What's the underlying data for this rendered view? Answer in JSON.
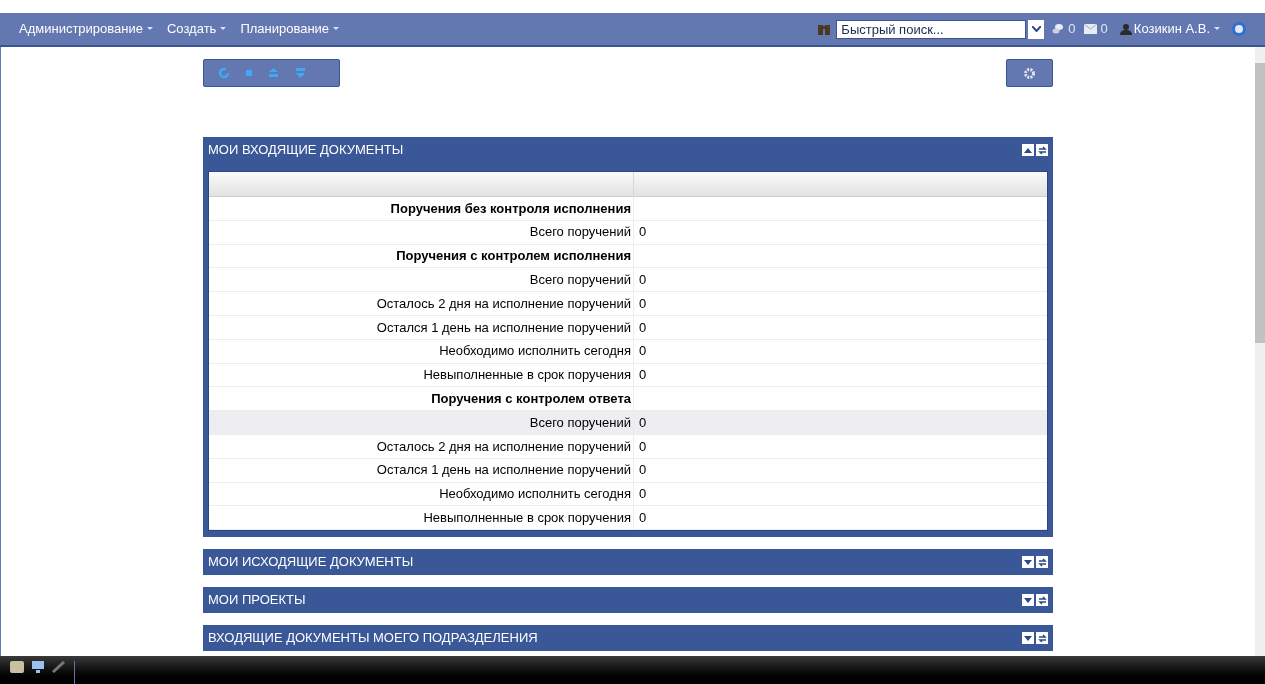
{
  "menu": [
    {
      "label": "Администрирование"
    },
    {
      "label": "Создать"
    },
    {
      "label": "Планирование"
    }
  ],
  "search": {
    "placeholder": "Быстрый поиск..."
  },
  "counters": [
    {
      "kind": "chat",
      "value": "0"
    },
    {
      "kind": "mail",
      "value": "0"
    }
  ],
  "user": {
    "name": "Козикин А.В."
  },
  "panels": [
    {
      "title": "МОИ ВХОДЯЩИЕ ДОКУМЕНТЫ",
      "expanded": true,
      "rows": [
        {
          "kind": "group",
          "label": "Поручения без контроля исполнения",
          "highlighted": false
        },
        {
          "kind": "item",
          "label": "Всего поручений",
          "value": "0",
          "highlighted": false
        },
        {
          "kind": "group",
          "label": "Поручения с контролем исполнения",
          "highlighted": false
        },
        {
          "kind": "item",
          "label": "Всего поручений",
          "value": "0",
          "highlighted": false
        },
        {
          "kind": "item",
          "label": "Осталось 2 дня на исполнение поручений",
          "value": "0",
          "highlighted": false
        },
        {
          "kind": "item",
          "label": "Остался 1 день на исполнение поручений",
          "value": "0",
          "highlighted": false
        },
        {
          "kind": "item",
          "label": "Необходимо исполнить сегодня",
          "value": "0",
          "highlighted": false
        },
        {
          "kind": "item",
          "label": "Невыполненные в срок поручения",
          "value": "0",
          "highlighted": false
        },
        {
          "kind": "group",
          "label": "Поручения с контролем ответа",
          "highlighted": false
        },
        {
          "kind": "item",
          "label": "Всего поручений",
          "value": "0",
          "highlighted": true
        },
        {
          "kind": "item",
          "label": "Осталось 2 дня на исполнение поручений",
          "value": "0",
          "highlighted": false
        },
        {
          "kind": "item",
          "label": "Остался 1 день на исполнение поручений",
          "value": "0",
          "highlighted": false
        },
        {
          "kind": "item",
          "label": "Необходимо исполнить сегодня",
          "value": "0",
          "highlighted": false
        },
        {
          "kind": "item",
          "label": "Невыполненные в срок поручения",
          "value": "0",
          "highlighted": false
        }
      ]
    },
    {
      "title": "МОИ ИСХОДЯЩИЕ ДОКУМЕНТЫ",
      "expanded": false
    },
    {
      "title": "МОИ ПРОЕКТЫ",
      "expanded": false
    },
    {
      "title": "ВХОДЯЩИЕ ДОКУМЕНТЫ МОЕГО ПОДРАЗДЕЛЕНИЯ",
      "expanded": false
    }
  ]
}
